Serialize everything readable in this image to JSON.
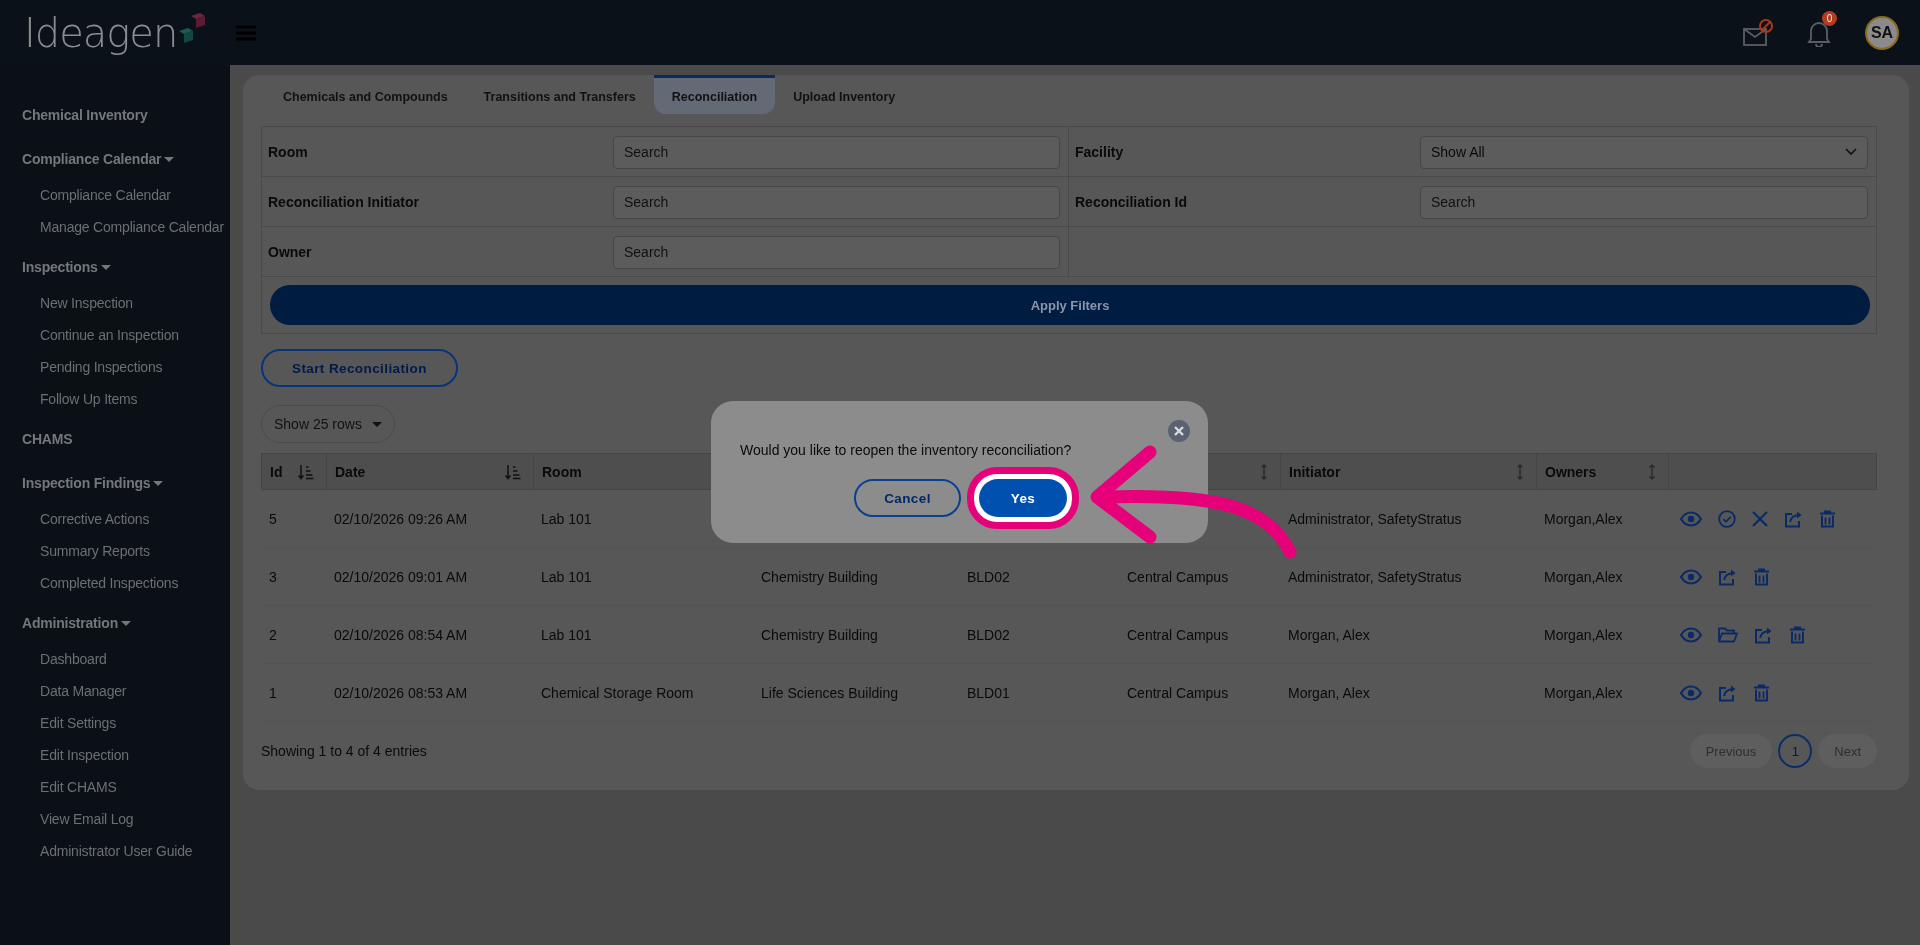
{
  "header": {
    "logo": "Ideagen",
    "notification_count": "0",
    "avatar": "SA"
  },
  "sidebar": {
    "sections": [
      {
        "label": "Chemical Inventory"
      },
      {
        "label": "Compliance Calendar",
        "expanded": true,
        "children": [
          {
            "label": "Compliance Calendar"
          },
          {
            "label": "Manage Compliance Calendar"
          }
        ]
      },
      {
        "label": "Inspections",
        "expanded": true,
        "children": [
          {
            "label": "New Inspection"
          },
          {
            "label": "Continue an Inspection"
          },
          {
            "label": "Pending Inspections"
          },
          {
            "label": "Follow Up Items"
          }
        ]
      },
      {
        "label": "CHAMS"
      },
      {
        "label": "Inspection Findings",
        "expanded": true,
        "children": [
          {
            "label": "Corrective Actions"
          },
          {
            "label": "Summary Reports"
          },
          {
            "label": "Completed Inspections"
          }
        ]
      },
      {
        "label": "Administration",
        "expanded": true,
        "children": [
          {
            "label": "Dashboard"
          },
          {
            "label": "Data Manager"
          },
          {
            "label": "Edit Settings"
          },
          {
            "label": "Edit Inspection"
          },
          {
            "label": "Edit CHAMS"
          },
          {
            "label": "View Email Log"
          },
          {
            "label": "Administrator User Guide"
          }
        ]
      }
    ]
  },
  "tabs": [
    {
      "label": "Chemicals and Compounds",
      "selected": false
    },
    {
      "label": "Transitions and Transfers",
      "selected": false
    },
    {
      "label": "Reconciliation",
      "selected": true
    },
    {
      "label": "Upload Inventory",
      "selected": false
    }
  ],
  "filters": [
    {
      "label": "Room",
      "kind": "text",
      "placeholder": "Search"
    },
    {
      "label": "Facility",
      "kind": "select",
      "value": "Show All"
    },
    {
      "label": "Reconciliation Initiator",
      "kind": "text",
      "placeholder": "Search"
    },
    {
      "label": "Reconciliation Id",
      "kind": "text",
      "placeholder": "Search"
    },
    {
      "label": "Owner",
      "kind": "text",
      "placeholder": "Search"
    }
  ],
  "apply_button": "Apply Filters",
  "start_button": "Start Reconciliation",
  "page_size": "Show 25 rows",
  "table": {
    "columns": [
      {
        "label": "Id",
        "sortable": true,
        "sorted": true
      },
      {
        "label": "Date",
        "sortable": true,
        "sorted": true
      },
      {
        "label": "Room"
      },
      {},
      {},
      {
        "sortable": true,
        "sorted": false
      },
      {
        "label": "Initiator",
        "sortable": true,
        "sorted": false
      },
      {
        "label": "Owners",
        "sortable": true,
        "sorted": false
      },
      {
        "sortable": false
      }
    ],
    "rows": [
      {
        "cells": [
          "5",
          "02/10/2026 09:26 AM",
          "Lab 101",
          null,
          null,
          null,
          "Administrator, SafetyStratus",
          "Morgan,Alex"
        ],
        "actions": [
          {
            "kind": "view"
          },
          {
            "kind": "approve"
          },
          {
            "kind": "close"
          },
          {
            "kind": "export"
          },
          {
            "kind": "delete"
          }
        ]
      },
      {
        "cells": [
          "3",
          "02/10/2026 09:01 AM",
          "Lab 101",
          "Chemistry Building",
          "BLD02",
          "Central Campus",
          "Administrator, SafetyStratus",
          "Morgan,Alex"
        ],
        "actions": [
          {
            "kind": "view"
          },
          {
            "kind": "export"
          },
          {
            "kind": "delete"
          }
        ]
      },
      {
        "cells": [
          "2",
          "02/10/2026 08:54 AM",
          "Lab 101",
          "Chemistry Building",
          "BLD02",
          "Central Campus",
          "Morgan, Alex",
          "Morgan,Alex"
        ],
        "actions": [
          {
            "kind": "view"
          },
          {
            "kind": "reopen"
          },
          {
            "kind": "export"
          },
          {
            "kind": "delete"
          }
        ]
      },
      {
        "cells": [
          "1",
          "02/10/2026 08:53 AM",
          "Chemical Storage Room",
          "Life Sciences Building",
          "BLD01",
          "Central Campus",
          "Morgan, Alex",
          "Morgan,Alex"
        ],
        "actions": [
          {
            "kind": "view"
          },
          {
            "kind": "export"
          },
          {
            "kind": "delete"
          }
        ]
      }
    ]
  },
  "table_info": "Showing 1 to 4 of 4 entries",
  "pagination": [
    {
      "label": "Previous",
      "selected": false,
      "disabled": true
    },
    {
      "label": "1",
      "selected": true,
      "disabled": false
    },
    {
      "label": "Next",
      "selected": false,
      "disabled": true
    }
  ],
  "modal": {
    "message": "Would you like to reopen the inventory reconciliation?",
    "buttons": [
      {
        "label": "Cancel",
        "kind": "secondary",
        "highlighted": false
      },
      {
        "label": "Yes",
        "kind": "primary",
        "highlighted": true
      }
    ]
  }
}
